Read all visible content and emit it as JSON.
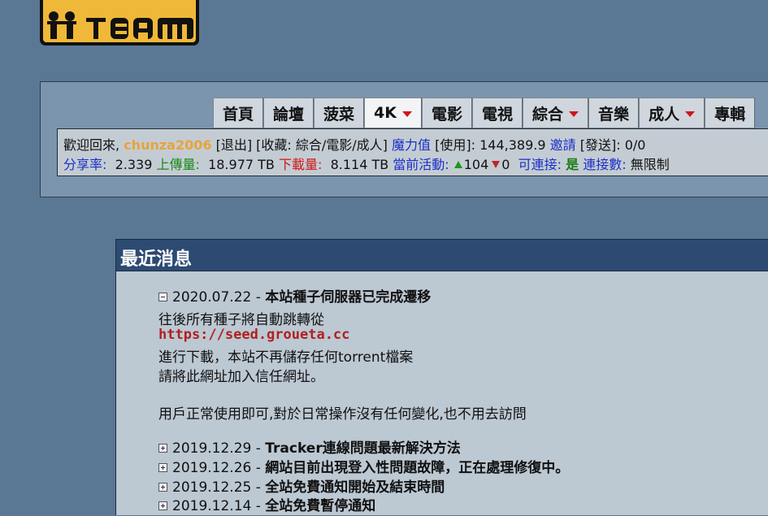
{
  "logo": {
    "text": "M-TEAM",
    "bg_color": "#f0b838"
  },
  "nav": {
    "tabs": [
      {
        "label": "首頁",
        "dropdown": false,
        "active": false
      },
      {
        "label": "論壇",
        "dropdown": false,
        "active": false
      },
      {
        "label": "菠菜",
        "dropdown": false,
        "active": false
      },
      {
        "label": "4K",
        "dropdown": true,
        "active": true
      },
      {
        "label": "電影",
        "dropdown": false,
        "active": false
      },
      {
        "label": "電視",
        "dropdown": false,
        "active": false
      },
      {
        "label": "綜合",
        "dropdown": true,
        "active": false
      },
      {
        "label": "音樂",
        "dropdown": false,
        "active": false
      },
      {
        "label": "成人",
        "dropdown": true,
        "active": false
      },
      {
        "label": "專輯",
        "dropdown": false,
        "active": false
      }
    ]
  },
  "user_info": {
    "welcome": "歡迎回來, ",
    "username": "chunza2006",
    "logout": "[退出]",
    "favorites": "[收藏: 綜合/電影/成人]",
    "bonus_label": "魔力值",
    "bonus_use": "[使用]: 144,389.9",
    "invite_label": "邀請",
    "invite_send": "[發送]: 0/0",
    "ratio_label": "分享率:",
    "ratio_value": "2.339",
    "upload_label": "上傳量:",
    "upload_value": "18.977 TB",
    "download_label": "下載量:",
    "download_value": "8.114 TB",
    "activity_label": "當前活動:",
    "seeding": "104",
    "leeching": "0",
    "connectable_label": "可連接:",
    "connectable_value": "是",
    "connections_label": "連接數:",
    "connections_value": "無限制"
  },
  "news": {
    "header": "最近消息",
    "items": [
      {
        "date": "2020.07.22",
        "sep": " - ",
        "title": "本站種子伺服器已完成遷移",
        "expanded": true
      },
      {
        "date": "2019.12.29",
        "sep": " - ",
        "title": "Tracker連線問題最新解決方法",
        "expanded": false
      },
      {
        "date": "2019.12.26",
        "sep": " - ",
        "title": "網站目前出現登入性問題故障，正在處理修復中。",
        "expanded": false
      },
      {
        "date": "2019.12.25",
        "sep": " - ",
        "title": "全站免費通知開始及結束時間",
        "expanded": false
      },
      {
        "date": "2019.12.14",
        "sep": " - ",
        "title": "全站免費暫停通知",
        "expanded": false
      }
    ],
    "body": {
      "line1": "往後所有種子將自動跳轉從",
      "link": "https://seed.groueta.cc",
      "line2": "進行下載，本站不再儲存任何torrent檔案",
      "line3": "請將此網址加入信任網址。",
      "line4": "用戶正常使用即可,對於日常操作沒有任何變化,也不用去訪問"
    }
  }
}
